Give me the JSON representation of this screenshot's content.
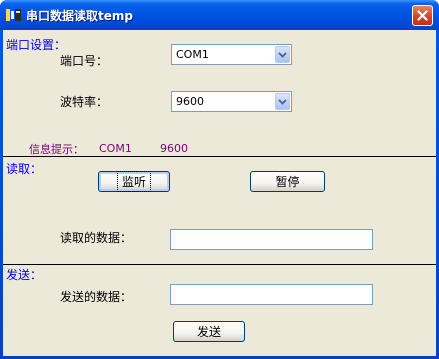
{
  "window": {
    "title": "串口数据读取temp",
    "close_glyph": "✕"
  },
  "config": {
    "section_label": "端口设置：",
    "port_label": "端口号：",
    "port_value": "COM1",
    "baud_label": "波特率：",
    "baud_value": "9600"
  },
  "info": {
    "label": "信息提示：",
    "port": "COM1",
    "baud": "9600"
  },
  "read": {
    "section_label": "读取：",
    "listen_button": "监听",
    "pause_button": "暂停",
    "data_label": "读取的数据：",
    "data_value": ""
  },
  "send": {
    "section_label": "发送：",
    "data_label": "发送的数据：",
    "data_value": "",
    "send_button": "发送"
  },
  "colors": {
    "section_text": "#0000ff",
    "info_text": "#800080",
    "client_bg": "#ece9d8"
  },
  "icons": {
    "app": "app-icon",
    "close": "close-icon",
    "dropdown": "chevron-down-icon"
  }
}
